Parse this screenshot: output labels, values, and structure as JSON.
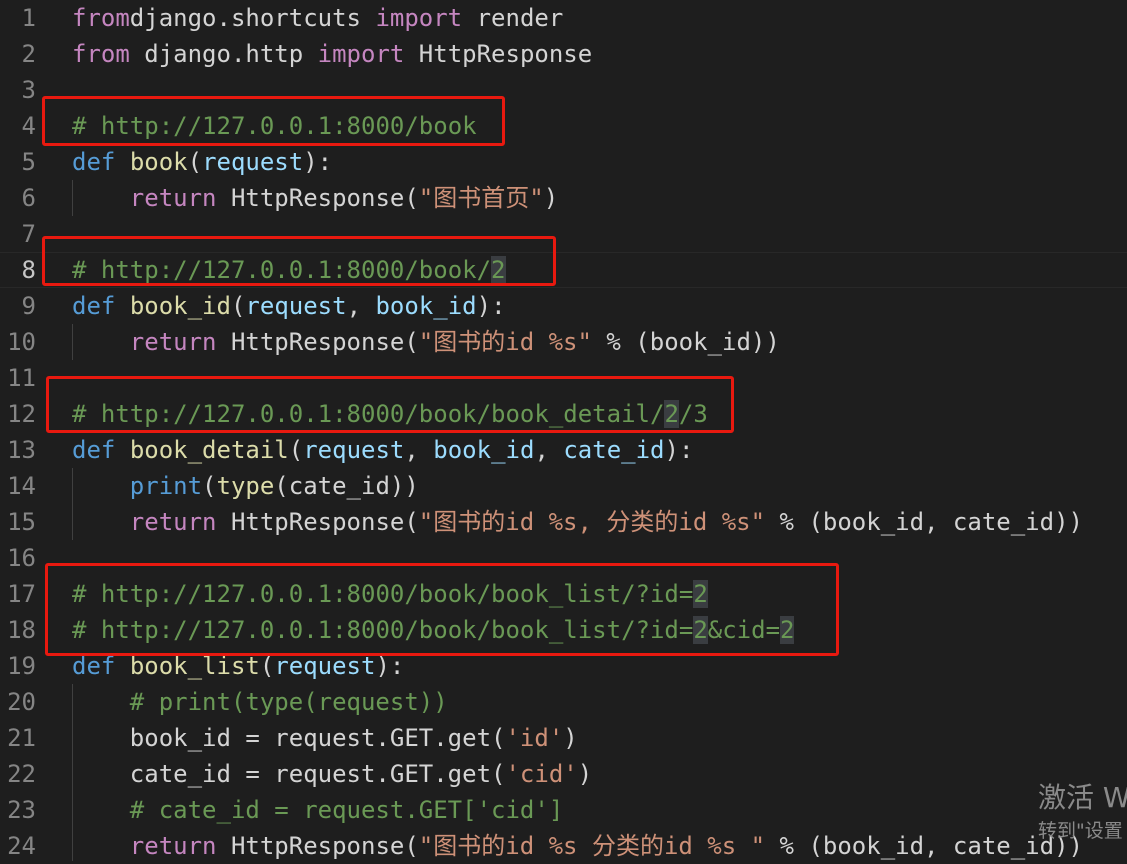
{
  "editor": {
    "lines": [
      {
        "n": "1",
        "tokens": [
          [
            "kw-ctrl",
            "from"
          ],
          [
            "",
            "django.shortcuts "
          ],
          [
            "kw-ctrl",
            "import"
          ],
          [
            "",
            " render"
          ]
        ]
      },
      {
        "n": "2",
        "tokens": [
          [
            "kw-ctrl",
            "from"
          ],
          [
            "",
            " django.http "
          ],
          [
            "kw-ctrl",
            "import"
          ],
          [
            "",
            " HttpResponse"
          ]
        ]
      },
      {
        "n": "3",
        "tokens": []
      },
      {
        "n": "4",
        "tokens": [
          [
            "cmt",
            "# "
          ],
          [
            "cmt url",
            "http://127.0.0.1:8000/book"
          ]
        ]
      },
      {
        "n": "5",
        "tokens": [
          [
            "kw-def",
            "def"
          ],
          [
            "",
            " "
          ],
          [
            "fn",
            "book"
          ],
          [
            "",
            "("
          ],
          [
            "param",
            "request"
          ],
          [
            "",
            "):"
          ]
        ]
      },
      {
        "n": "6",
        "tokens": [
          [
            "",
            "    "
          ],
          [
            "kw-ctrl",
            "return"
          ],
          [
            "",
            " HttpResponse("
          ],
          [
            "str",
            "\"图书首页\""
          ],
          [
            "",
            ")"
          ]
        ]
      },
      {
        "n": "7",
        "tokens": []
      },
      {
        "n": "8",
        "tokens": [
          [
            "cmt",
            "# "
          ],
          [
            "cmt url",
            "http://127.0.0.1:8000/book/"
          ],
          [
            "cmt url hl",
            "2"
          ]
        ]
      },
      {
        "n": "9",
        "tokens": [
          [
            "kw-def",
            "def"
          ],
          [
            "",
            " "
          ],
          [
            "fn",
            "book_id"
          ],
          [
            "",
            "("
          ],
          [
            "param",
            "request"
          ],
          [
            "",
            ", "
          ],
          [
            "param",
            "book_id"
          ],
          [
            "",
            "):"
          ]
        ]
      },
      {
        "n": "10",
        "tokens": [
          [
            "",
            "    "
          ],
          [
            "kw-ctrl",
            "return"
          ],
          [
            "",
            " HttpResponse("
          ],
          [
            "str",
            "\"图书的id %s\""
          ],
          [
            "",
            " % (book_id))"
          ]
        ]
      },
      {
        "n": "11",
        "tokens": []
      },
      {
        "n": "12",
        "tokens": [
          [
            "cmt",
            "# "
          ],
          [
            "cmt url",
            "http://127.0.0.1:8000/book/book_detail/"
          ],
          [
            "cmt url hl",
            "2"
          ],
          [
            "cmt url",
            "/3"
          ]
        ]
      },
      {
        "n": "13",
        "tokens": [
          [
            "kw-def",
            "def"
          ],
          [
            "",
            " "
          ],
          [
            "fn",
            "book_detail"
          ],
          [
            "",
            "("
          ],
          [
            "param",
            "request"
          ],
          [
            "",
            ", "
          ],
          [
            "param",
            "book_id"
          ],
          [
            "",
            ", "
          ],
          [
            "param",
            "cate_id"
          ],
          [
            "",
            "):"
          ]
        ]
      },
      {
        "n": "14",
        "tokens": [
          [
            "",
            "    "
          ],
          [
            "kw-def",
            "print"
          ],
          [
            "",
            "("
          ],
          [
            "fn",
            "type"
          ],
          [
            "",
            "(cate_id))"
          ]
        ]
      },
      {
        "n": "15",
        "tokens": [
          [
            "",
            "    "
          ],
          [
            "kw-ctrl",
            "return"
          ],
          [
            "",
            " HttpResponse("
          ],
          [
            "str",
            "\"图书的id %s, 分类的id %s\""
          ],
          [
            "",
            " % (book_id, cate_id))"
          ]
        ]
      },
      {
        "n": "16",
        "tokens": []
      },
      {
        "n": "17",
        "tokens": [
          [
            "cmt",
            "# "
          ],
          [
            "cmt url",
            "http://127.0.0.1:8000/book/book_list/?id="
          ],
          [
            "cmt url hl",
            "2"
          ]
        ]
      },
      {
        "n": "18",
        "tokens": [
          [
            "cmt",
            "# "
          ],
          [
            "cmt url",
            "http://127.0.0.1:8000/book/book_list/?id="
          ],
          [
            "cmt url hl",
            "2"
          ],
          [
            "cmt url",
            "&cid="
          ],
          [
            "cmt url hl",
            "2"
          ]
        ]
      },
      {
        "n": "19",
        "tokens": [
          [
            "kw-def",
            "def"
          ],
          [
            "",
            " "
          ],
          [
            "fn",
            "book_list"
          ],
          [
            "",
            "("
          ],
          [
            "param",
            "request"
          ],
          [
            "",
            "):"
          ]
        ]
      },
      {
        "n": "20",
        "tokens": [
          [
            "",
            "    "
          ],
          [
            "cmt",
            "# print(type(request))"
          ]
        ]
      },
      {
        "n": "21",
        "tokens": [
          [
            "",
            "    book_id = request.GET.get("
          ],
          [
            "str",
            "'id'"
          ],
          [
            "",
            ")"
          ]
        ]
      },
      {
        "n": "22",
        "tokens": [
          [
            "",
            "    cate_id = request.GET.get("
          ],
          [
            "str",
            "'cid'"
          ],
          [
            "",
            ")"
          ]
        ]
      },
      {
        "n": "23",
        "tokens": [
          [
            "",
            "    "
          ],
          [
            "cmt",
            "# cate_id = request.GET['cid']"
          ]
        ]
      },
      {
        "n": "24",
        "tokens": [
          [
            "",
            "    "
          ],
          [
            "kw-ctrl",
            "return"
          ],
          [
            "",
            " HttpResponse("
          ],
          [
            "str",
            "\"图书的id %s 分类的id %s \""
          ],
          [
            "",
            " % (book_id, cate_id))"
          ]
        ]
      }
    ],
    "active_line": "8"
  },
  "watermark": {
    "line1": "激活 W",
    "line2": "转到\"设置"
  },
  "colors": {
    "background": "#1e1e1e",
    "highlight_box": "#e8190f",
    "comment": "#6a9955",
    "keyword_control": "#c586c0",
    "keyword_def": "#569cd6",
    "function": "#dcdcaa",
    "parameter": "#9cdcfe",
    "string": "#ce9178"
  }
}
